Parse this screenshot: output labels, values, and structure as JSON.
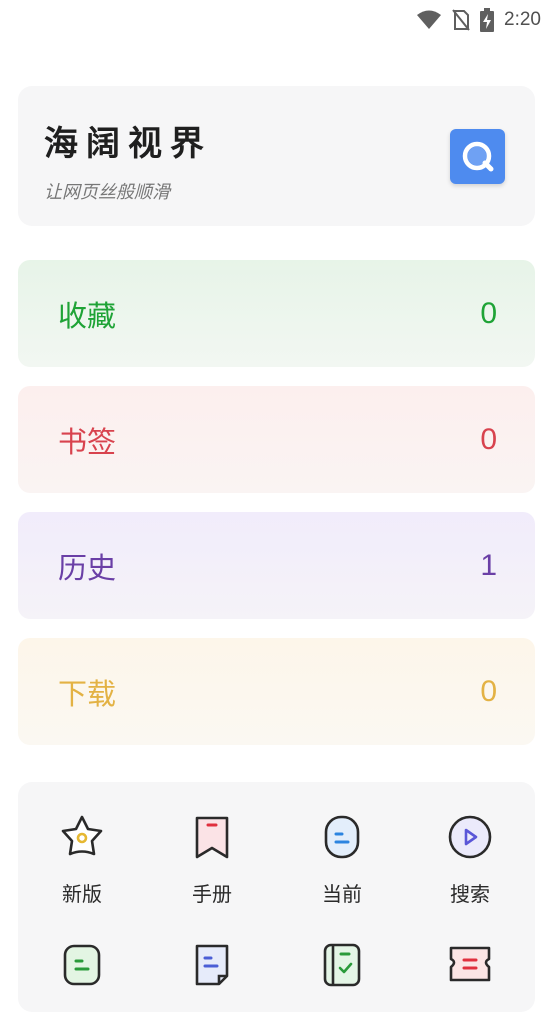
{
  "status_bar": {
    "time": "2:20"
  },
  "brand": {
    "title": "海阔视界",
    "subtitle": "让网页丝般顺滑",
    "logo_icon": "search-bubble-icon",
    "logo_color": "#4e8bef"
  },
  "stats": {
    "favorites": {
      "label": "收藏",
      "count": "0",
      "color": "#1fa336"
    },
    "bookmarks": {
      "label": "书签",
      "count": "0",
      "color": "#d8434e"
    },
    "history": {
      "label": "历史",
      "count": "1",
      "color": "#6a3fa6"
    },
    "downloads": {
      "label": "下载",
      "count": "0",
      "color": "#e3b244"
    }
  },
  "shortcuts": [
    {
      "label": "新版",
      "icon": "star-icon"
    },
    {
      "label": "手册",
      "icon": "bookmark-icon"
    },
    {
      "label": "当前",
      "icon": "capsule-icon"
    },
    {
      "label": "搜索",
      "icon": "play-circle-icon"
    },
    {
      "label": "",
      "icon": "note-icon"
    },
    {
      "label": "",
      "icon": "document-icon"
    },
    {
      "label": "",
      "icon": "book-check-icon"
    },
    {
      "label": "",
      "icon": "ticket-icon"
    }
  ]
}
